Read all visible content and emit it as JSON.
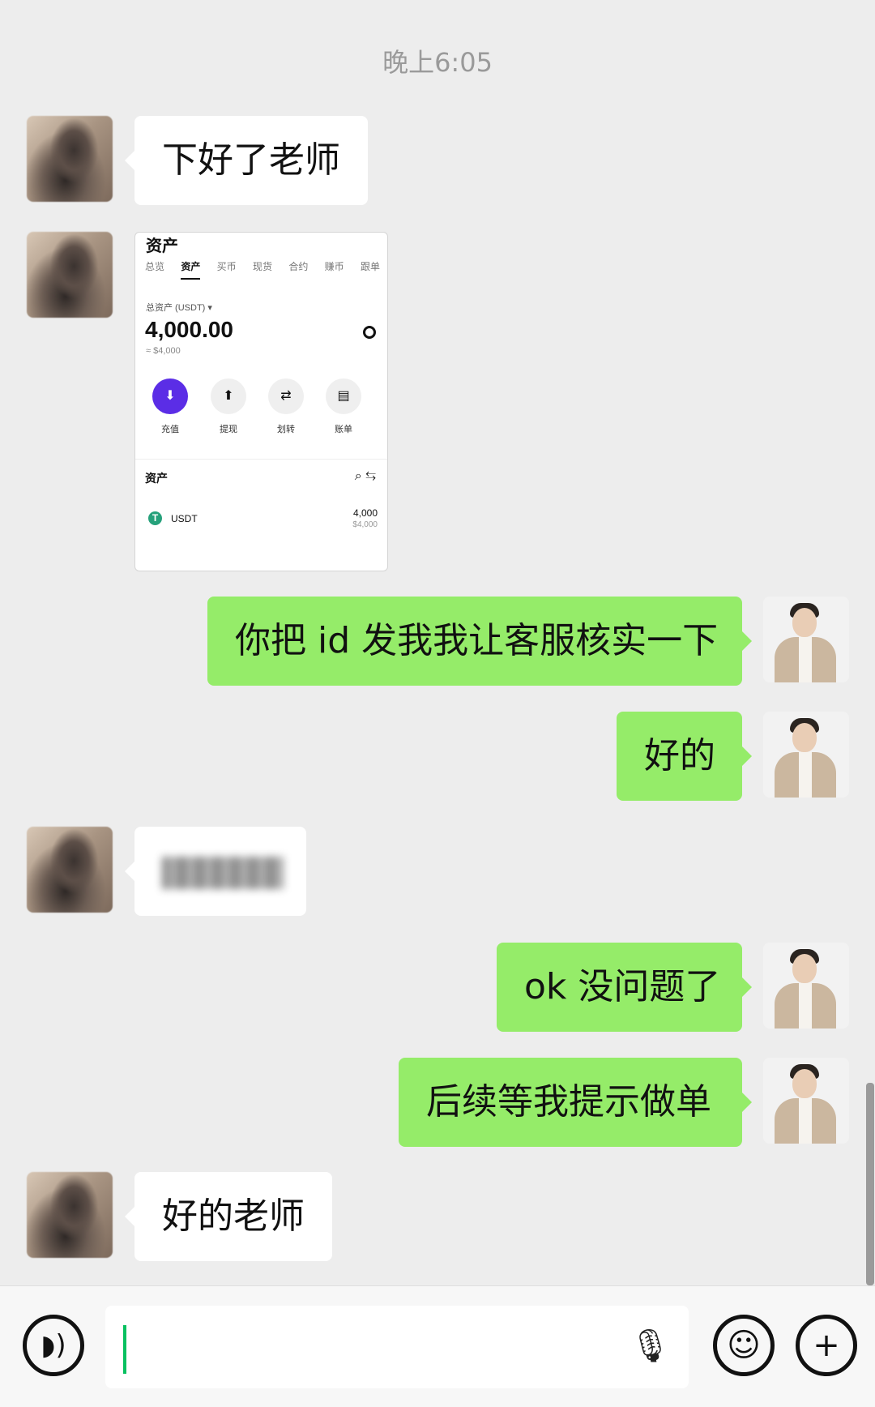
{
  "timestamp": "晚上6:05",
  "messages": {
    "m1": "下好了老师",
    "m3": "你把 id 发我我让客服核实一下",
    "m4": "好的",
    "m6": "ok 没问题了",
    "m7": "后续等我提示做单",
    "m8": "好的老师"
  },
  "screenshot_card": {
    "title": "资产",
    "tabs": [
      "总览",
      "资产",
      "买币",
      "现货",
      "合约",
      "赚币",
      "跟单"
    ],
    "total_label": "总资产 (USDT) ▾",
    "amount": "4,000.00",
    "approx": "≈ $4,000",
    "actions": [
      "充值",
      "提现",
      "划转",
      "账单"
    ],
    "assets_heading": "资产",
    "coin_name": "USDT",
    "coin_amount": "4,000",
    "coin_value": "$4,000"
  },
  "icons": {
    "voice": "voice-icon",
    "mic": "microphone-icon",
    "emoji": "emoji-icon",
    "plus": "plus-icon"
  },
  "colors": {
    "sent_bubble": "#95ec69",
    "received_bubble": "#ffffff",
    "background": "#ededed",
    "cursor": "#07c160"
  }
}
